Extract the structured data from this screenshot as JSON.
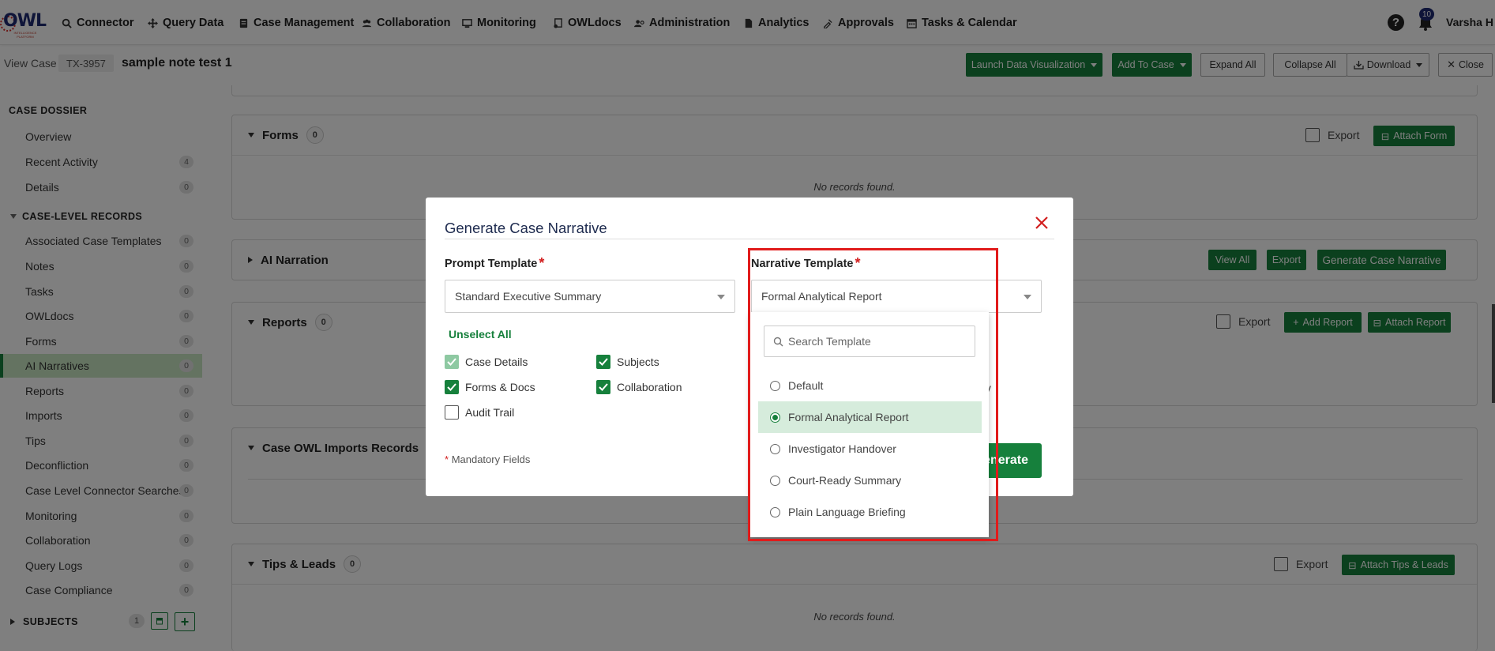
{
  "nav": {
    "logo_text": "OWL",
    "logo_sub": "INTELLIGENCE PLATFORM",
    "items": [
      {
        "label": "Connector",
        "icon": "search-icon"
      },
      {
        "label": "Query Data",
        "icon": "move-icon"
      },
      {
        "label": "Case Management",
        "icon": "case-icon"
      },
      {
        "label": "Collaboration",
        "icon": "users-icon"
      },
      {
        "label": "Monitoring",
        "icon": "monitor-icon"
      },
      {
        "label": "OWLdocs",
        "icon": "docs-icon"
      },
      {
        "label": "Administration",
        "icon": "admin-icon"
      },
      {
        "label": "Analytics",
        "icon": "file-icon"
      },
      {
        "label": "Approvals",
        "icon": "approvals-icon"
      },
      {
        "label": "Tasks & Calendar",
        "icon": "calendar-icon"
      }
    ],
    "help": "?",
    "notifications": "10",
    "user": "Varsha H"
  },
  "subheader": {
    "view_label": "View Case",
    "case_id": "TX-3957",
    "case_title": "sample note test 1",
    "buttons": {
      "launch": "Launch Data Visualization",
      "add_to_case": "Add To Case",
      "expand_all": "Expand All",
      "collapse_all": "Collapse All",
      "download": "Download",
      "close": "Close"
    }
  },
  "sidebar": {
    "dossier_title": "CASE DOSSIER",
    "dossier_items": [
      {
        "label": "Overview",
        "count": null
      },
      {
        "label": "Recent Activity",
        "count": "4"
      },
      {
        "label": "Details",
        "count": "0"
      }
    ],
    "records_title": "CASE-LEVEL RECORDS",
    "record_items": [
      {
        "label": "Associated Case Templates",
        "count": "0"
      },
      {
        "label": "Notes",
        "count": "0"
      },
      {
        "label": "Tasks",
        "count": "0"
      },
      {
        "label": "OWLdocs",
        "count": "0"
      },
      {
        "label": "Forms",
        "count": "0"
      },
      {
        "label": "AI Narratives",
        "count": "0"
      },
      {
        "label": "Reports",
        "count": "0"
      },
      {
        "label": "Imports",
        "count": "0"
      },
      {
        "label": "Tips",
        "count": "0"
      },
      {
        "label": "Deconfliction",
        "count": "0"
      },
      {
        "label": "Case Level Connector Searches",
        "count": "0"
      },
      {
        "label": "Monitoring",
        "count": "0"
      },
      {
        "label": "Collaboration",
        "count": "0"
      },
      {
        "label": "Query Logs",
        "count": "0"
      },
      {
        "label": "Case Compliance",
        "count": "0"
      }
    ],
    "subjects_title": "SUBJECTS",
    "subjects_count": "1"
  },
  "panels": {
    "forms": {
      "title": "Forms",
      "count": "0",
      "export": "Export",
      "attach": "Attach Form",
      "empty": "No records found."
    },
    "ai": {
      "title": "AI Narration",
      "view_all": "View All",
      "export": "Export",
      "generate": "Generate Case Narrative"
    },
    "reports": {
      "title": "Reports",
      "count": "0",
      "export": "Export",
      "add": "Add Report",
      "attach": "Attach Report"
    },
    "imports": {
      "title": "Case OWL Imports Records"
    },
    "tips": {
      "title": "Tips & Leads",
      "count": "0",
      "export": "Export",
      "attach": "Attach Tips & Leads",
      "empty": "No records found."
    }
  },
  "modal": {
    "title": "Generate Case Narrative",
    "prompt_label": "Prompt Template",
    "prompt_value": "Standard Executive Summary",
    "narrative_label": "Narrative Template",
    "narrative_value": "Formal Analytical Report",
    "unselect_all": "Unselect All",
    "checks": [
      {
        "label": "Case Details",
        "state": "dim"
      },
      {
        "label": "Subjects",
        "state": "on"
      },
      {
        "label": "Forms & Docs",
        "state": "on"
      },
      {
        "label": "Collaboration",
        "state": "on"
      },
      {
        "label": "Audit Trail",
        "state": "off"
      }
    ],
    "partial_text": "ty",
    "mandatory": "Mandatory Fields",
    "generate_partial": "enerate"
  },
  "dropdown": {
    "search_placeholder": "Search Template",
    "options": [
      {
        "label": "Default",
        "selected": false
      },
      {
        "label": "Formal Analytical Report",
        "selected": true
      },
      {
        "label": "Investigator Handover",
        "selected": false
      },
      {
        "label": "Court-Ready Summary",
        "selected": false
      },
      {
        "label": "Plain Language Briefing",
        "selected": false
      }
    ]
  },
  "colors": {
    "accent": "#16803c",
    "highlight": "#e11b1b",
    "brand": "#1e2b72"
  }
}
